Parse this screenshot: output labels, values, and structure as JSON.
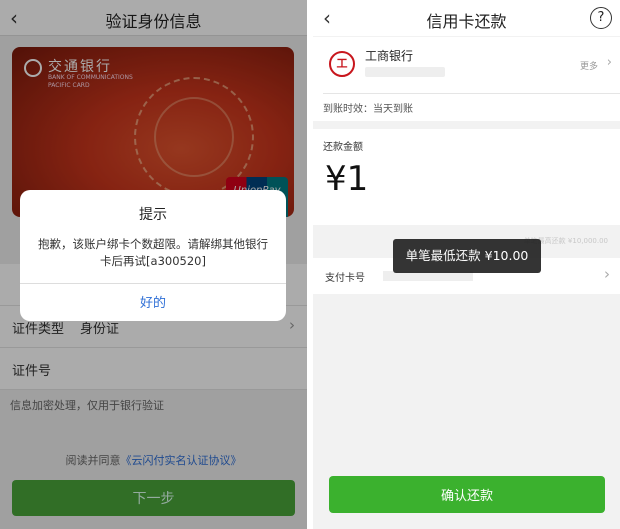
{
  "left": {
    "nav": {
      "back_icon": "chevron-left-icon",
      "title": "验证身份信息"
    },
    "card": {
      "bank_name_cn": "交通银行",
      "bank_name_en": "BANK OF COMMUNICATIONS",
      "card_type_en": "PACIFIC CARD",
      "network": "UnionPay"
    },
    "rows": {
      "id_type_label": "证件类型",
      "id_type_value": "身份证",
      "id_number_label": "证件号"
    },
    "info_text": "信息加密处理，仅用于银行验证",
    "agreement_prefix": "阅读并同意",
    "agreement_link": "《云闪付实名认证协议》",
    "next_button": "下一步",
    "dialog": {
      "title": "提示",
      "message": "抱歉，该账户绑卡个数超限。请解绑其他银行卡后再试[a300520]",
      "ok_button": "好的"
    }
  },
  "right": {
    "nav": {
      "back_icon": "chevron-left-icon",
      "title": "信用卡还款",
      "help_icon": "question-circle-icon"
    },
    "bank": {
      "name": "工商银行",
      "logo_text": "工",
      "more": "更多",
      "arrival_text": "到账时效：当天到账"
    },
    "amount": {
      "label": "还款金额",
      "value": "¥1",
      "max_text": "单笔最高还款 ¥10,000.00"
    },
    "payment": {
      "label": "支付卡号"
    },
    "toast": "单笔最低还款 ¥10.00",
    "confirm_button": "确认还款"
  },
  "colors": {
    "brand_green": "#3bb12e",
    "link_blue": "#2f6fd6",
    "icbc_red": "#c8161d"
  }
}
